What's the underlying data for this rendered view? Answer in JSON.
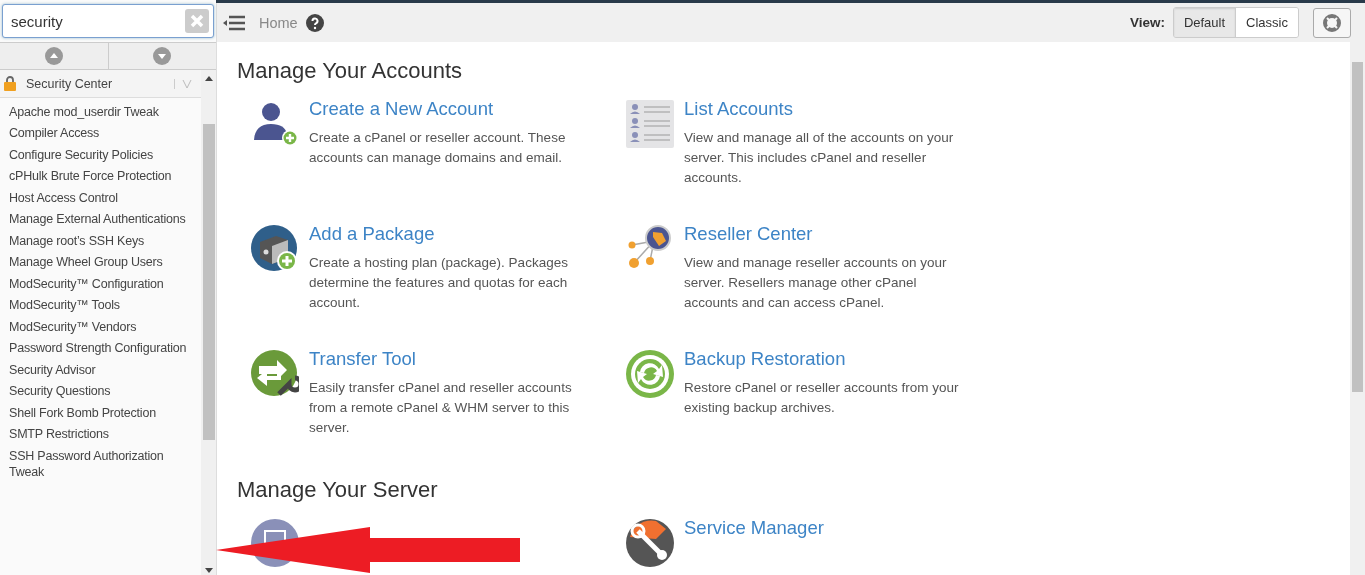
{
  "search": {
    "value": "security"
  },
  "sidebar": {
    "group": {
      "title": "Security Center",
      "items": [
        "Apache mod_userdir Tweak",
        "Compiler Access",
        "Configure Security Policies",
        "cPHulk Brute Force Protection",
        "Host Access Control",
        "Manage External Authentications",
        "Manage root’s SSH Keys",
        "Manage Wheel Group Users",
        "ModSecurity™ Configuration",
        "ModSecurity™ Tools",
        "ModSecurity™ Vendors",
        "Password Strength Configuration",
        "Security Advisor",
        "Security Questions",
        "Shell Fork Bomb Protection",
        "SMTP Restrictions",
        "SSH Password Authorization Tweak"
      ]
    }
  },
  "breadcrumb": {
    "home": "Home"
  },
  "view_switch": {
    "label": "View:",
    "options": [
      {
        "label": "Default",
        "selected": true
      },
      {
        "label": "Classic",
        "selected": false
      }
    ]
  },
  "sections": [
    {
      "title": "Manage Your Accounts",
      "cards": [
        {
          "kind": "person-add",
          "title": "Create a New Account",
          "description": "Create a cPanel or reseller account. These accounts can manage domains and email."
        },
        {
          "kind": "list",
          "title": "List Accounts",
          "description": "View and manage all of the accounts on your server. This includes cPanel and reseller accounts."
        },
        {
          "kind": "package",
          "title": "Add a Package",
          "description": "Create a hosting plan (package). Packages determine the features and quotas for each account."
        },
        {
          "kind": "reseller",
          "title": "Reseller Center",
          "description": "View and manage reseller accounts on your server. Resellers manage other cPanel accounts and can access cPanel."
        },
        {
          "kind": "transfer",
          "title": "Transfer Tool",
          "description": "Easily transfer cPanel and reseller accounts from a remote cPanel & WHM server to this server."
        },
        {
          "kind": "backup",
          "title": "Backup Restoration",
          "description": "Restore cPanel or reseller accounts from your existing backup archives."
        }
      ]
    },
    {
      "title": "Manage Your Server",
      "cards": [
        {
          "kind": "server"
        },
        {
          "kind": "service",
          "title": "Service Manager"
        }
      ]
    }
  ]
}
